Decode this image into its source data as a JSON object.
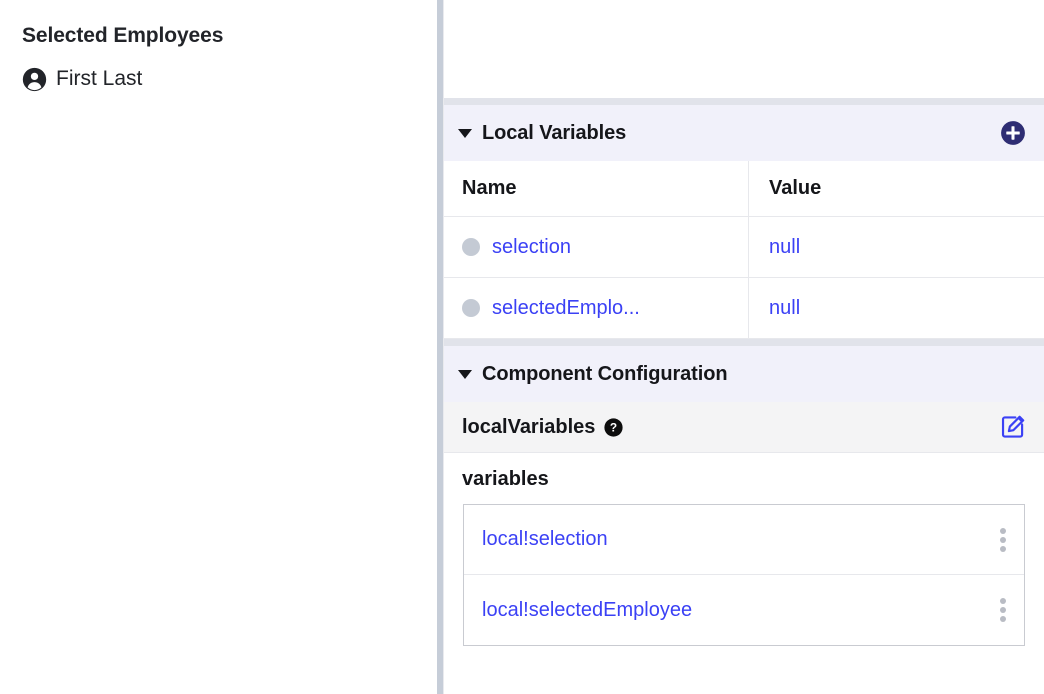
{
  "left_panel": {
    "title": "Selected Employees",
    "employee": {
      "icon": "user-avatar-icon",
      "name": "First Last"
    }
  },
  "right_panel": {
    "local_variables_section": {
      "caret_icon": "caret-down-icon",
      "title": "Local Variables",
      "add_icon": "plus-circle-icon",
      "table": {
        "columns": [
          "Name",
          "Value"
        ],
        "rows": [
          {
            "dot": "status-dot-icon",
            "name": "selection",
            "value": "null"
          },
          {
            "dot": "status-dot-icon",
            "name": "selectedEmplo...",
            "value": "null"
          }
        ]
      }
    },
    "component_configuration_section": {
      "caret_icon": "caret-down-icon",
      "title": "Component Configuration",
      "field": {
        "label": "localVariables",
        "help_icon": "help-question-icon",
        "edit_icon": "edit-pencil-icon"
      },
      "subfield": {
        "label": "variables",
        "items": [
          {
            "text": "local!selection",
            "menu_icon": "kebab-menu-icon"
          },
          {
            "text": "local!selectedEmployee",
            "menu_icon": "kebab-menu-icon"
          }
        ]
      }
    }
  },
  "colors": {
    "link": "#3b41f5",
    "accent_navy": "#2e2d73",
    "section_header_bg": "#f1f1fa",
    "splitter": "#c6cdd8",
    "dot_gray": "#c4cad4"
  }
}
